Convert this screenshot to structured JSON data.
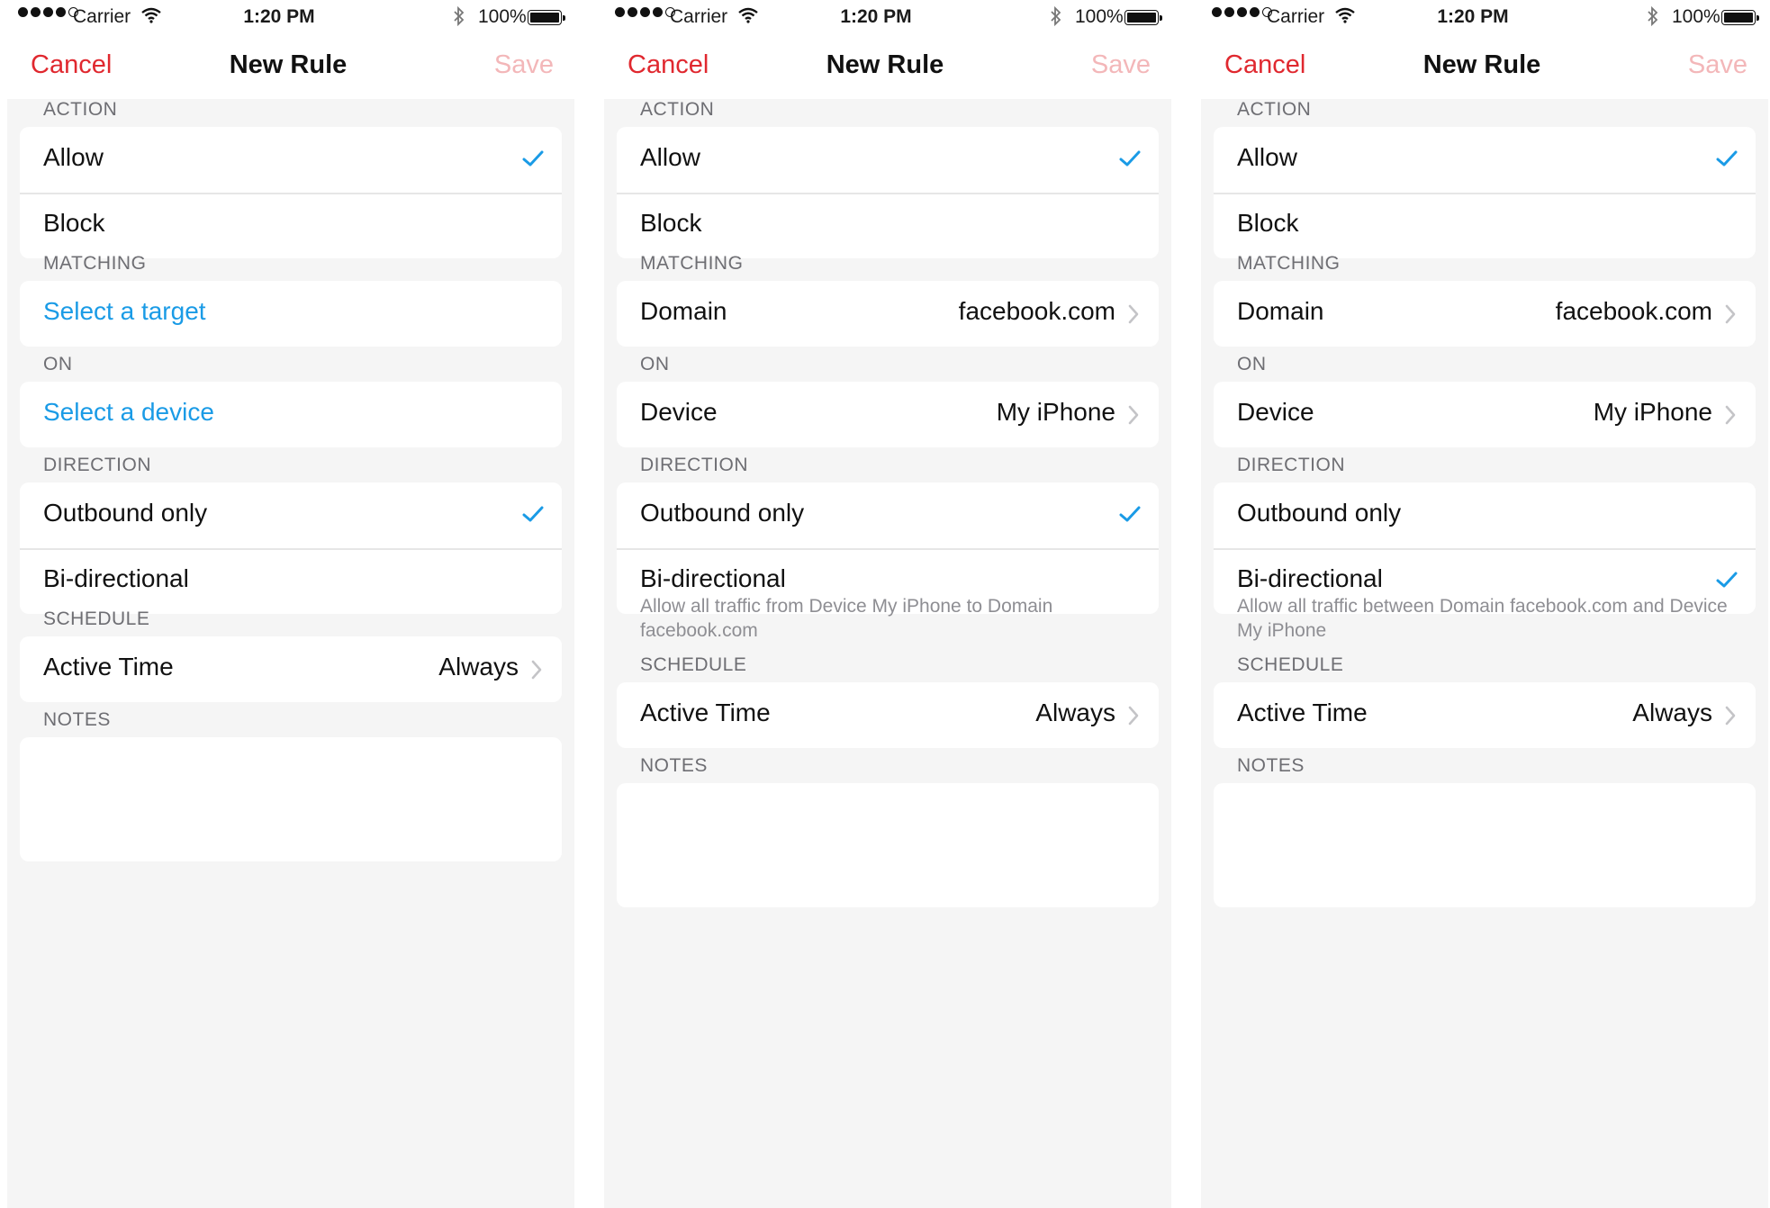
{
  "status_bar": {
    "carrier": "Carrier",
    "time": "1:20 PM",
    "battery": "100%"
  },
  "nav": {
    "cancel": "Cancel",
    "title": "New Rule",
    "save": "Save"
  },
  "colors": {
    "accent_red": "#e0282f",
    "save_disabled": "#f3b7b9",
    "link_blue": "#1a9be6",
    "check_blue": "#1a9be6",
    "background": "#f5f5f5"
  },
  "icons": {
    "check": "checkmark-icon",
    "chevron": "chevron-right-icon",
    "wifi": "wifi-icon",
    "bluetooth": "bluetooth-icon",
    "battery": "battery-icon"
  },
  "sections": {
    "action": "ACTION",
    "matching": "MATCHING",
    "on": "ON",
    "direction": "DIRECTION",
    "schedule": "SCHEDULE",
    "notes": "NOTES"
  },
  "labels": {
    "allow": "Allow",
    "block": "Block",
    "select_target": "Select a target",
    "select_device": "Select a device",
    "domain": "Domain",
    "device": "Device",
    "outbound": "Outbound only",
    "bidirectional": "Bi-directional",
    "active_time": "Active Time"
  },
  "values": {
    "domain": "facebook.com",
    "device": "My iPhone",
    "active_time": "Always"
  },
  "screens": [
    {
      "action_selected": "Allow",
      "direction_selected": "Outbound only",
      "description": ""
    },
    {
      "action_selected": "Allow",
      "direction_selected": "Outbound only",
      "description": "Allow all traffic from Device My iPhone to Domain facebook.com"
    },
    {
      "action_selected": "Allow",
      "direction_selected": "Bi-directional",
      "description": "Allow all traffic between Domain facebook.com and Device My iPhone"
    }
  ]
}
